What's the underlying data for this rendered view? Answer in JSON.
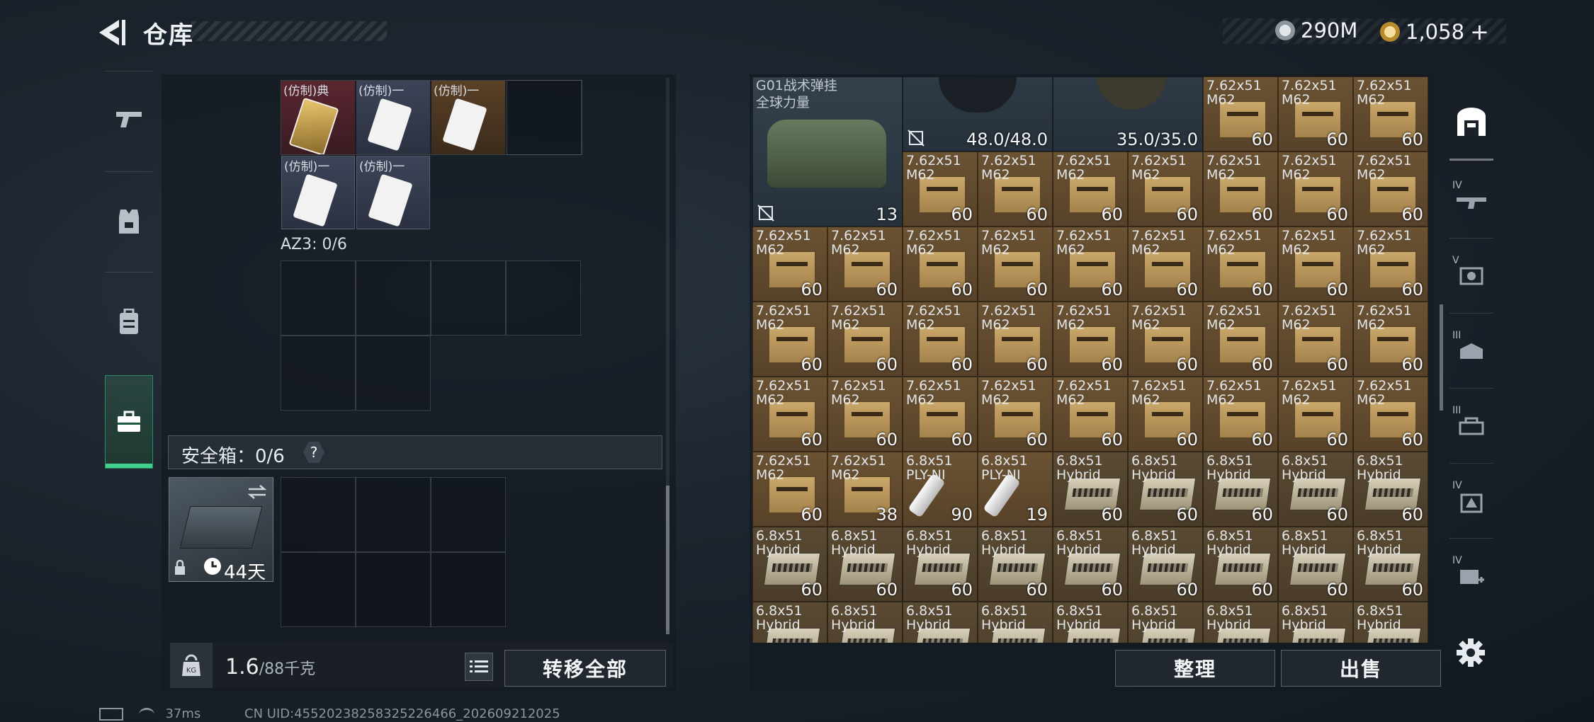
{
  "header": {
    "title": "仓库",
    "currency_silver": "290M",
    "currency_gold": "1,058",
    "plus": "+"
  },
  "left_nav": [
    {
      "name": "weapon"
    },
    {
      "name": "armor"
    },
    {
      "name": "backpack"
    },
    {
      "name": "case",
      "active": true
    }
  ],
  "pouch": {
    "items": [
      {
        "label": "(仿制)典",
        "style": "red"
      },
      {
        "label": "(仿制)一",
        "style": "blue"
      },
      {
        "label": "(仿制)一",
        "style": "gold"
      },
      {
        "label": "(仿制)一",
        "style": "blue"
      },
      {
        "label": "(仿制)一",
        "style": "blue"
      }
    ],
    "az3_label": "AZ3: 0/6"
  },
  "safe": {
    "label": "安全箱：0/6",
    "help": "?",
    "days": "44天"
  },
  "footer_left": {
    "weight": "1.6",
    "weight_unit": "/88千克",
    "transfer_all": "转移全部"
  },
  "footer_right": {
    "sort": "整理",
    "sell": "出售"
  },
  "stash": {
    "rig_name": "G01战术弹挂",
    "rig_sub": "全球力量",
    "rig_count": "13",
    "helmet1_durability": "48.0/48.0",
    "helmet2_durability": "35.0/35.0",
    "ammo_762_n1": "7.62x51",
    "ammo_762_n2": "M62",
    "ammo_68_n1": "6.8x51",
    "ammo_68_n2": "Hybrid",
    "ammo_ply_n2": "PLY-NI",
    "slots": [
      {
        "t": "762",
        "q": "60"
      },
      {
        "t": "762",
        "q": "60"
      },
      {
        "t": "762",
        "q": "60"
      },
      {
        "t": "762",
        "q": "60"
      },
      {
        "t": "762",
        "q": "60"
      },
      {
        "t": "762",
        "q": "60"
      },
      {
        "t": "762",
        "q": "60"
      },
      {
        "t": "762",
        "q": "60"
      },
      {
        "t": "762",
        "q": "60"
      },
      {
        "t": "762",
        "q": "60"
      },
      {
        "t": "762",
        "q": "60"
      },
      {
        "t": "762",
        "q": "60"
      },
      {
        "t": "762",
        "q": "60"
      },
      {
        "t": "762",
        "q": "60"
      },
      {
        "t": "762",
        "q": "60"
      },
      {
        "t": "762",
        "q": "60"
      },
      {
        "t": "762",
        "q": "60"
      },
      {
        "t": "762",
        "q": "60"
      },
      {
        "t": "762",
        "q": "60"
      },
      {
        "t": "762",
        "q": "60"
      },
      {
        "t": "762",
        "q": "60"
      },
      {
        "t": "762",
        "q": "60"
      },
      {
        "t": "762",
        "q": "60"
      },
      {
        "t": "762",
        "q": "60"
      },
      {
        "t": "762",
        "q": "60"
      },
      {
        "t": "762",
        "q": "60"
      },
      {
        "t": "762",
        "q": "60"
      },
      {
        "t": "762",
        "q": "60"
      },
      {
        "t": "762",
        "q": "60"
      },
      {
        "t": "762",
        "q": "60"
      },
      {
        "t": "762",
        "q": "60"
      },
      {
        "t": "762",
        "q": "60"
      },
      {
        "t": "762",
        "q": "60"
      },
      {
        "t": "762",
        "q": "60"
      },
      {
        "t": "762",
        "q": "60"
      },
      {
        "t": "762",
        "q": "60"
      },
      {
        "t": "762",
        "q": "60"
      },
      {
        "t": "762",
        "q": "60"
      },
      {
        "t": "762",
        "q": "38"
      },
      {
        "t": "ply",
        "q": "90"
      },
      {
        "t": "ply",
        "q": "19"
      },
      {
        "t": "68",
        "q": "60"
      },
      {
        "t": "68",
        "q": "60"
      },
      {
        "t": "68",
        "q": "60"
      },
      {
        "t": "68",
        "q": "60"
      },
      {
        "t": "68",
        "q": "60"
      },
      {
        "t": "68",
        "q": "60"
      },
      {
        "t": "68",
        "q": "60"
      },
      {
        "t": "68",
        "q": "60"
      },
      {
        "t": "68",
        "q": "60"
      },
      {
        "t": "68",
        "q": "60"
      },
      {
        "t": "68",
        "q": "60"
      },
      {
        "t": "68",
        "q": "60"
      },
      {
        "t": "68",
        "q": "60"
      },
      {
        "t": "68",
        "q": "60"
      },
      {
        "t": "68",
        "q": ""
      },
      {
        "t": "68",
        "q": ""
      },
      {
        "t": "68",
        "q": ""
      },
      {
        "t": "68",
        "q": ""
      },
      {
        "t": "68",
        "q": ""
      },
      {
        "t": "68",
        "q": ""
      },
      {
        "t": "68",
        "q": ""
      },
      {
        "t": "68",
        "q": ""
      },
      {
        "t": "68",
        "q": ""
      }
    ]
  },
  "right_nav": [
    {
      "name": "container",
      "tier": ""
    },
    {
      "name": "weapon-filter",
      "tier": "IV"
    },
    {
      "name": "armor-filter",
      "tier": "V"
    },
    {
      "name": "helmet-filter",
      "tier": "III"
    },
    {
      "name": "rig-filter",
      "tier": "III"
    },
    {
      "name": "backpack-filter",
      "tier": "IV"
    },
    {
      "name": "medical-filter",
      "tier": "IV"
    }
  ],
  "status": {
    "ping": "37ms",
    "uid": "CN UID:4552023825832522646​6_202609212025"
  }
}
